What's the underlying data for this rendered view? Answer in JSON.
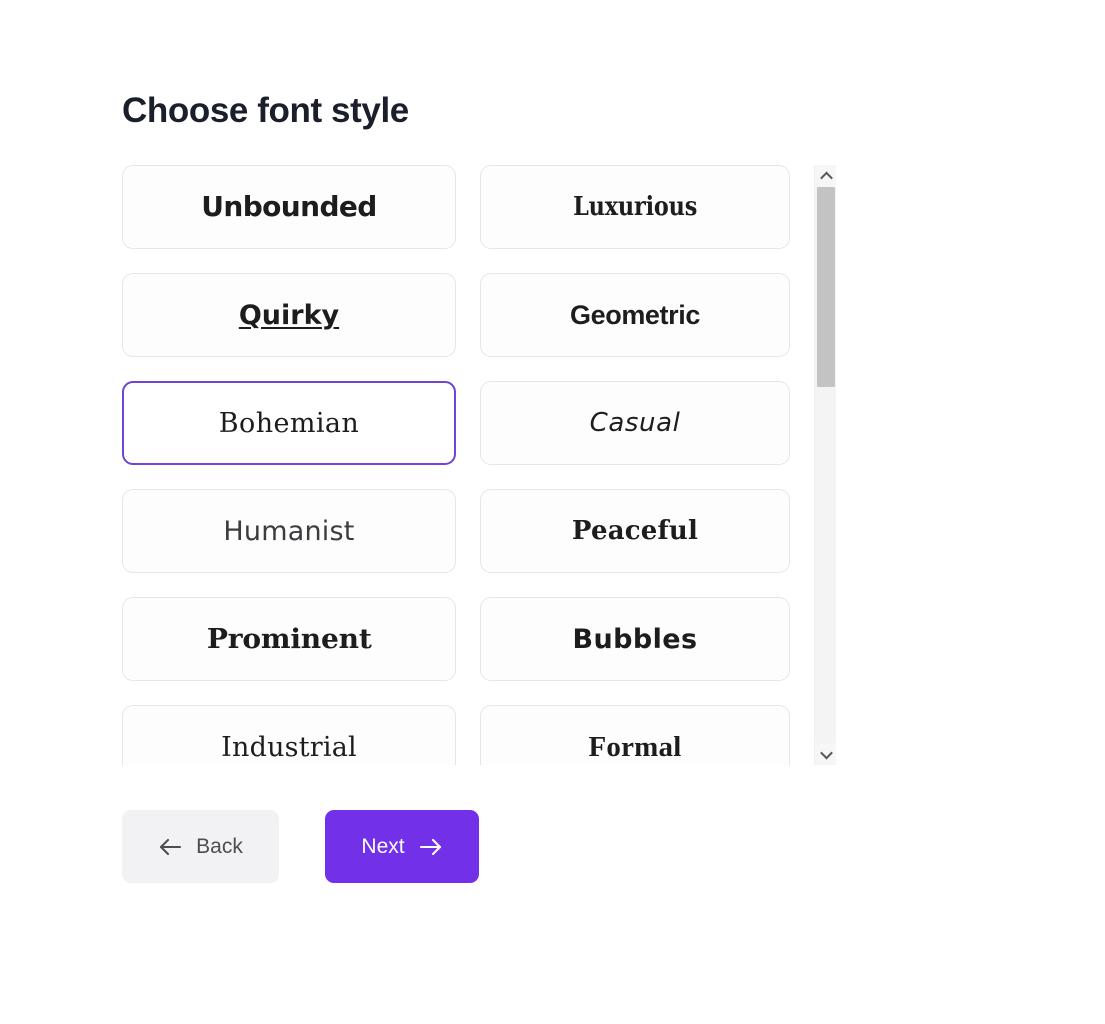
{
  "header": {
    "title": "Choose font style"
  },
  "colors": {
    "accent": "#7231e8",
    "selected_border": "#7044d6",
    "card_border": "#e6e7e9",
    "title_text": "#1b1f2b",
    "back_bg": "#f2f2f4",
    "back_text": "#4d4d52",
    "scrollbar_thumb": "#c3c3c3",
    "scrollbar_track": "#f4f4f4",
    "page_bg": "#ffffff"
  },
  "font_styles": [
    {
      "label": "Unbounded",
      "selected": false
    },
    {
      "label": "Luxurious",
      "selected": false
    },
    {
      "label": "Quirky",
      "selected": false
    },
    {
      "label": "Geometric",
      "selected": false
    },
    {
      "label": "Bohemian",
      "selected": true
    },
    {
      "label": "Casual",
      "selected": false
    },
    {
      "label": "Humanist",
      "selected": false
    },
    {
      "label": "Peaceful",
      "selected": false
    },
    {
      "label": "Prominent",
      "selected": false
    },
    {
      "label": "Bubbles",
      "selected": false
    },
    {
      "label": "Industrial",
      "selected": false
    },
    {
      "label": "Formal",
      "selected": false
    }
  ],
  "selected_style": "Bohemian",
  "scrollbar": {
    "up_icon": "chevron-up-icon",
    "down_icon": "chevron-down-icon",
    "thumb_position_percent": 0,
    "thumb_size_percent": 36
  },
  "footer": {
    "back_label": "Back",
    "back_icon": "arrow-left-icon",
    "next_label": "Next",
    "next_icon": "arrow-right-icon"
  }
}
